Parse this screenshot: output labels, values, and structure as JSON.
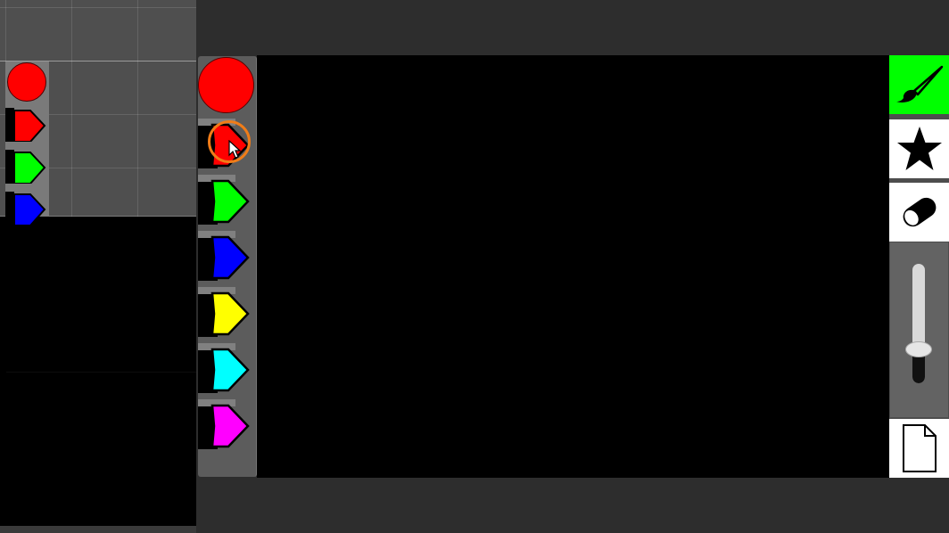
{
  "colors": {
    "current": "#ff0000",
    "brush_active_bg": "#00ff00",
    "cursor_ring": "#f07c18"
  },
  "palette": {
    "current_color_icon": "circle-filled",
    "swatches": [
      {
        "name": "red",
        "color": "#ff0000"
      },
      {
        "name": "green",
        "color": "#00ff00"
      },
      {
        "name": "blue",
        "color": "#0000ff"
      },
      {
        "name": "yellow",
        "color": "#ffff00"
      },
      {
        "name": "cyan",
        "color": "#00ffff"
      },
      {
        "name": "magenta",
        "color": "#ff00ff"
      }
    ]
  },
  "mini_palette": {
    "swatches": [
      {
        "color": "#ff0000"
      },
      {
        "color": "#00ff00"
      },
      {
        "color": "#0000ff"
      }
    ]
  },
  "toolbar": {
    "tools": [
      {
        "name": "brush",
        "icon": "paintbrush-icon",
        "active": true
      },
      {
        "name": "star",
        "icon": "star-icon",
        "active": false
      },
      {
        "name": "eraser",
        "icon": "eraser-icon",
        "active": false
      },
      {
        "name": "new",
        "icon": "new-page-icon",
        "active": false
      }
    ],
    "brush_size_fraction": 0.28
  }
}
